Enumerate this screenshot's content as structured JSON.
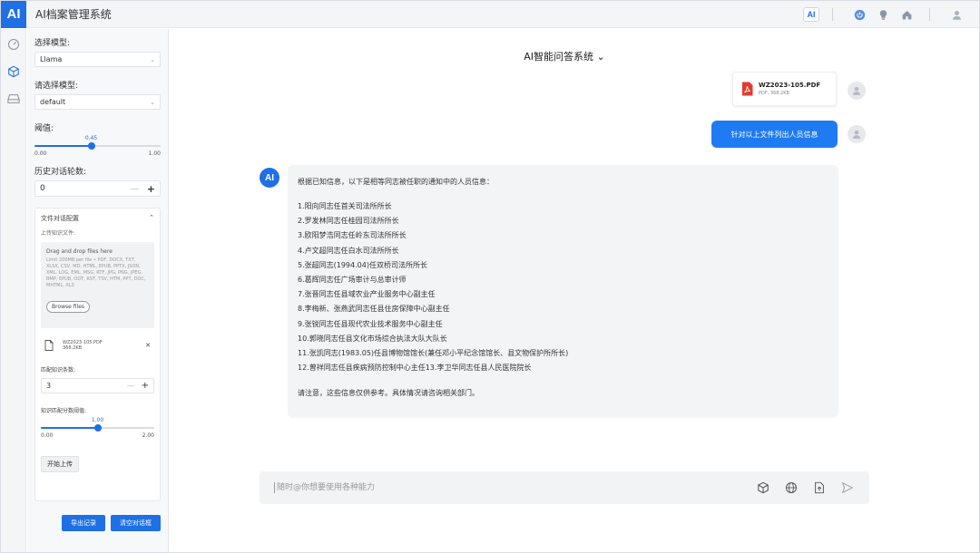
{
  "app": {
    "logo": "AI",
    "title": "AI档案管理系统"
  },
  "topbar": {
    "ai_chip": "AI",
    "icons": [
      "power-icon",
      "bulb-icon",
      "home-icon",
      "user-icon"
    ]
  },
  "rail": {
    "icons": [
      "gauge-icon",
      "cube-icon",
      "drive-icon"
    ]
  },
  "panel": {
    "model_label": "选择模型:",
    "model_value": "Llama",
    "embed_label": "请选择模型:",
    "embed_value": "default",
    "threshold_label": "阈值:",
    "threshold": {
      "value": "0.45",
      "min": "0.00",
      "max": "1.00",
      "fraction": 0.45
    },
    "history_label": "历史对话轮数:",
    "history_value": "0",
    "upload": {
      "header": "文件对话配置",
      "sub": "上传知识文件:",
      "drop_title": "Drag and drop files here",
      "drop_desc": "Limit 200MB per file • PDF, DOCX, TXT, XLSX, CSV, MD, HTML, EPUB, PPTX, JSON, XML, LOG, EML, MSG, RTF, JPG, PNG, JPEG, BMP, EPUB, ODT, RST, TSV, HTM, PPT, DOC, MHTML, XLS",
      "browse": "Browse files",
      "file_name": "WZ2023-105.PDF",
      "file_size": "368.2KB",
      "match_label": "匹配知识条数:",
      "match_value": "3",
      "score_label": "知识匹配分数阈值:",
      "score": {
        "value": "1.00",
        "min": "0.00",
        "max": "2.00",
        "fraction": 0.5
      },
      "start_button": "开始上传"
    },
    "export_button": "导出记录",
    "clear_button": "清空对话框"
  },
  "chat": {
    "title": "AI智能问答系统",
    "attachment": {
      "name": "WZ2023-105.PDF",
      "meta": "PDF, 368.2KB"
    },
    "user_message": "针对以上文件列出人员信息",
    "ai_avatar": "AI",
    "ai_intro": "根据已知信息，以下是相等同志被任职的通知中的人员信息：",
    "ai_items": [
      "1.阳向同志任首关司法所所长",
      "2.罗发林同志任桂园司法所所长",
      "3.欧阳梦浩同志任岭东司法所所长",
      "4.卢文超同志任白水司法所所长",
      "5.张超同志(1994.04)任双桥司法所所长",
      "6.葛辉同志任广场审计与总审计师",
      "7.张晋同志任县域农业产业服务中心副主任",
      "8.李梅新、张燕武同志任县住房保障中心副主任",
      "9.张锐同志任县现代农业技术服务中心副主任",
      "10.郭晓同志任县文化市场综合执法大队大队长",
      "11.张凯同志(1983.05)任县博物馆馆长(兼任邓小平纪念馆馆长、县文物保护所所长)",
      "12.曾祥同志任县疾病预防控制中心主任13.李卫华同志任县人民医院院长"
    ],
    "ai_note": "请注意，这些信息仅供参考。具体情况请咨询相关部门。",
    "input_placeholder": "随时@你想要使用各种能力"
  },
  "colors": {
    "accent": "#1f6fe5",
    "bubble": "#1f7bf2"
  }
}
